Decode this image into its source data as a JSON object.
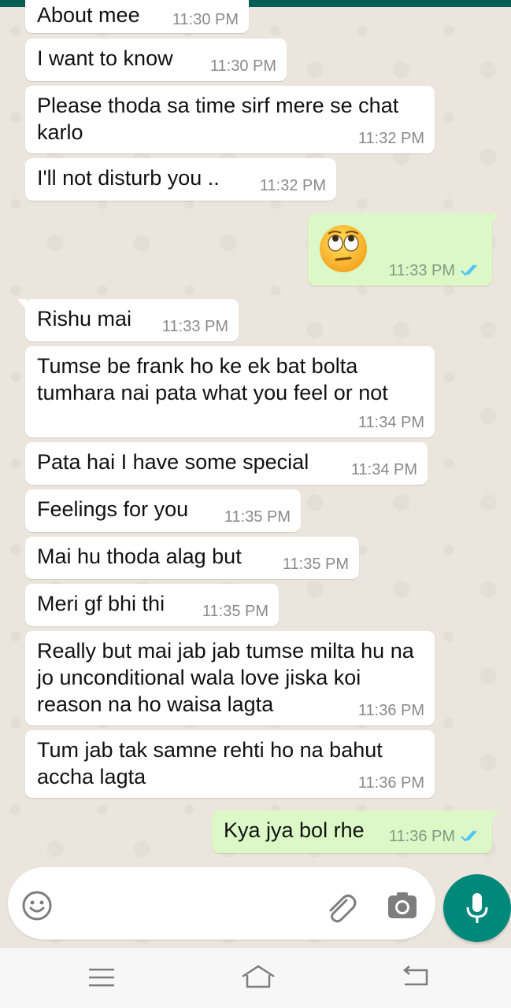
{
  "messages": [
    {
      "text": "About mee",
      "time": "11:30 PM",
      "dir": "in"
    },
    {
      "text": "I want to know",
      "time": "11:30 PM",
      "dir": "in"
    },
    {
      "text": "Please thoda sa time sirf mere se chat karlo",
      "time": "11:32 PM",
      "dir": "in"
    },
    {
      "text": "I'll not disturb you ..",
      "time": "11:32 PM",
      "dir": "in"
    },
    {
      "text": "",
      "emoji": "face-with-rolling-eyes-emoji",
      "time": "11:33 PM",
      "dir": "out",
      "status": "read"
    },
    {
      "text": "Rishu mai",
      "time": "11:33 PM",
      "dir": "in"
    },
    {
      "text": "Tumse be frank ho ke ek bat bolta tumhara nai pata what you feel or not",
      "time": "11:34 PM",
      "dir": "in"
    },
    {
      "text": "Pata hai I have some special",
      "time": "11:34 PM",
      "dir": "in"
    },
    {
      "text": "Feelings for you",
      "time": "11:35 PM",
      "dir": "in"
    },
    {
      "text": "Mai hu thoda alag but",
      "time": "11:35 PM",
      "dir": "in"
    },
    {
      "text": "Meri gf bhi thi",
      "time": "11:35 PM",
      "dir": "in"
    },
    {
      "text": "Really but mai jab jab tumse milta hu na jo unconditional wala love jiska koi reason na ho waisa lagta",
      "time": "11:36 PM",
      "dir": "in"
    },
    {
      "text": "Tum jab tak samne rehti ho na bahut accha lagta",
      "time": "11:36 PM",
      "dir": "in"
    },
    {
      "text": "Kya jya bol rhe",
      "time": "11:36 PM",
      "dir": "out",
      "status": "read"
    }
  ],
  "composer": {
    "placeholder": "",
    "icons": [
      "emoji-icon",
      "attach-icon",
      "camera-icon",
      "mic-icon"
    ]
  },
  "navbar": {
    "icons": [
      "menu-icon",
      "home-icon",
      "back-icon"
    ]
  },
  "colors": {
    "header": "#075e54",
    "wallpaper": "#ece5dd",
    "incoming": "#ffffff",
    "outgoing": "#dcf8c6",
    "accent": "#00897b",
    "read_ticks": "#4fc3f7"
  }
}
